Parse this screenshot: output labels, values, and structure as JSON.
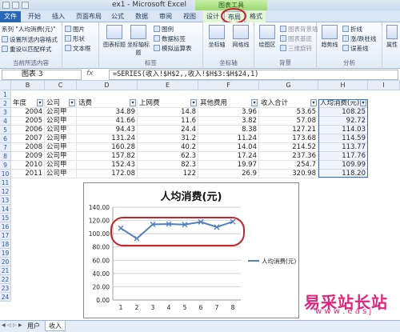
{
  "window": {
    "title": "ex1 - Microsoft Excel",
    "context_tab_title": "图表工具"
  },
  "ribbon_tabs": [
    {
      "label": "文件"
    },
    {
      "label": "开始"
    },
    {
      "label": "插入"
    },
    {
      "label": "页面布局"
    },
    {
      "label": "公式"
    },
    {
      "label": "数据"
    },
    {
      "label": "审阅"
    },
    {
      "label": "视图"
    },
    {
      "label": "设计"
    },
    {
      "label": "布局"
    },
    {
      "label": "格式"
    }
  ],
  "ribbon": {
    "current_selection": {
      "dropdown_value": "系列 \"人均消费(元)\"",
      "format_selection": "设置所选内容格式",
      "reset_style": "重设以匹配样式",
      "group_label": "当前所选内容"
    },
    "insert_group": {
      "picture": "图片",
      "shapes": "形状",
      "textbox": "文本框"
    },
    "labels_group": {
      "chart_title": "图表标题",
      "axis_title": "坐标轴标题",
      "legend": "图例",
      "data_labels": "数据标签",
      "data_table": "模拟运算表",
      "group_label": "标签"
    },
    "axes_group": {
      "axes": "坐标轴",
      "gridlines": "网格线",
      "group_label": "坐标轴"
    },
    "background_group": {
      "plot_area": "绘图区",
      "chart_wall": "图表背景墙",
      "chart_floor": "图表基底",
      "rotation": "三维旋转",
      "group_label": "背景"
    },
    "analysis_group": {
      "trendline": "趋势线",
      "lines": "折线",
      "updown_bars": "涨/跌柱线",
      "error_bars": "误差线",
      "group_label": "分析"
    },
    "properties": "属性"
  },
  "formula_bar": {
    "name_box": "图表 3",
    "fx": "fx",
    "formula": "=SERIES(收入!$H$2,,收入!$H$3:$H$24,1)"
  },
  "columns": [
    "B",
    "C",
    "D",
    "E",
    "F",
    "G",
    "H",
    "I"
  ],
  "table": {
    "headers": [
      "年度",
      "公司",
      "话费",
      "上网费",
      "其他费用",
      "收入合计",
      "人均消费(元)"
    ],
    "rows": [
      {
        "row": "3",
        "year": "2004",
        "company": "公司甲",
        "phone": "34.89",
        "net": "14.8",
        "other": "3.96",
        "total": "53.65",
        "avg": "108.25"
      },
      {
        "row": "4",
        "year": "2005",
        "company": "公司甲",
        "phone": "41.66",
        "net": "11.6",
        "other": "3.82",
        "total": "57.08",
        "avg": "92.72"
      },
      {
        "row": "5",
        "year": "2006",
        "company": "公司甲",
        "phone": "94.43",
        "net": "24.4",
        "other": "8.38",
        "total": "127.21",
        "avg": "114.03"
      },
      {
        "row": "6",
        "year": "2007",
        "company": "公司甲",
        "phone": "131.24",
        "net": "31.2",
        "other": "11.24",
        "total": "173.68",
        "avg": "114.59"
      },
      {
        "row": "7",
        "year": "2008",
        "company": "公司甲",
        "phone": "160.28",
        "net": "40.2",
        "other": "14.04",
        "total": "214.52",
        "avg": "113.77"
      },
      {
        "row": "8",
        "year": "2009",
        "company": "公司甲",
        "phone": "157.82",
        "net": "62.3",
        "other": "17.24",
        "total": "237.36",
        "avg": "117.76"
      },
      {
        "row": "9",
        "year": "2010",
        "company": "公司甲",
        "phone": "152.43",
        "net": "82.3",
        "other": "19.97",
        "total": "254.7",
        "avg": "109.99"
      },
      {
        "row": "10",
        "year": "2011",
        "company": "公司甲",
        "phone": "172.08",
        "net": "122",
        "other": "26.9",
        "total": "320.98",
        "avg": "118.20"
      }
    ],
    "header_row": "2",
    "row_labels_extra": [
      "1",
      "11",
      "12",
      "13",
      "14",
      "15",
      "16",
      "17",
      "18",
      "19",
      "20",
      "21",
      "22",
      "23",
      "24"
    ]
  },
  "chart_data": {
    "type": "line",
    "title": "人均消费(元)",
    "categories": [
      "1",
      "2",
      "3",
      "4",
      "5",
      "6",
      "7",
      "8"
    ],
    "series": [
      {
        "name": "人均消费(元)",
        "values": [
          108.25,
          92.72,
          114.03,
          114.59,
          113.77,
          117.76,
          109.99,
          118.2
        ],
        "color": "#4f81bd"
      }
    ],
    "ylim": [
      0,
      140
    ],
    "yticks": [
      "0.00",
      "20.00",
      "40.00",
      "60.00",
      "80.00",
      "100.00",
      "120.00",
      "140.00"
    ],
    "grid": true,
    "legend_position": "right"
  },
  "sheet_tabs": [
    "用户",
    "收入"
  ],
  "watermark": {
    "main": "易采站长站",
    "sub": "w w w . e a s j"
  },
  "colors": {
    "accent": "#2a66b8",
    "highlight": "#c8232c",
    "series": "#4f81bd"
  }
}
